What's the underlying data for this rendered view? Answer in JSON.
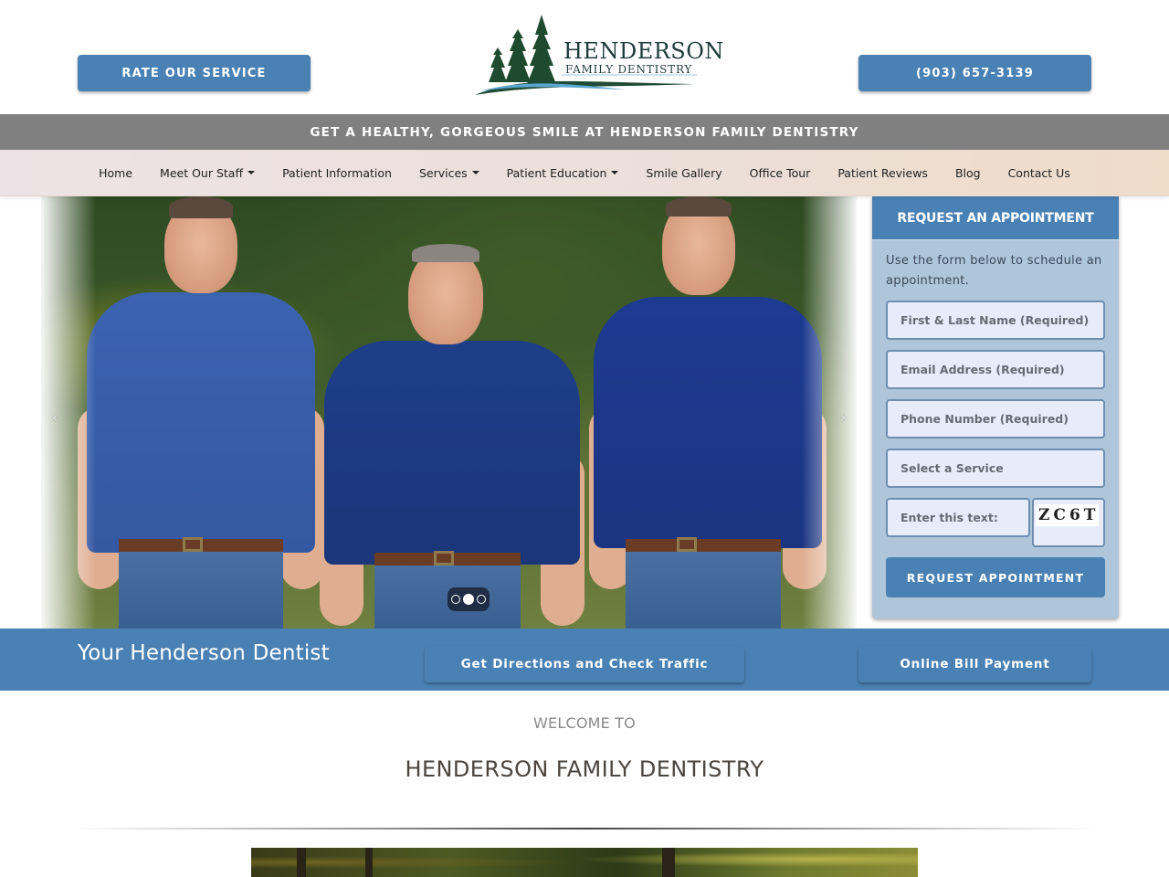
{
  "header": {
    "rate_button": "RATE OUR SERVICE",
    "phone_button": "(903) 657-3139",
    "logo": {
      "name": "HENDERSON",
      "subtitle": "FAMILY DENTISTRY",
      "icon": "pine-trees-logo-icon"
    }
  },
  "tagline": "GET A HEALTHY, GORGEOUS SMILE AT HENDERSON FAMILY DENTISTRY",
  "nav": {
    "items": [
      {
        "label": "Home",
        "dropdown": false
      },
      {
        "label": "Meet Our Staff",
        "dropdown": true
      },
      {
        "label": "Patient Information",
        "dropdown": false
      },
      {
        "label": "Services",
        "dropdown": true
      },
      {
        "label": "Patient Education",
        "dropdown": true
      },
      {
        "label": "Smile Gallery",
        "dropdown": false
      },
      {
        "label": "Office Tour",
        "dropdown": false
      },
      {
        "label": "Patient Reviews",
        "dropdown": false
      },
      {
        "label": "Blog",
        "dropdown": false
      },
      {
        "label": "Contact Us",
        "dropdown": false
      }
    ]
  },
  "hero": {
    "prev_icon": "‹",
    "next_icon": "›",
    "slides_total": 3,
    "active_slide": 2
  },
  "appointment": {
    "title": "REQUEST AN APPOINTMENT",
    "intro": "Use the form below to schedule an appointment.",
    "fields": {
      "name_placeholder": "First & Last Name (Required)",
      "email_placeholder": "Email Address (Required)",
      "phone_placeholder": "Phone Number (Required)",
      "service_selected": "Select a Service",
      "captcha_placeholder": "Enter this text:"
    },
    "captcha_text": "ZC6T",
    "submit": "REQUEST APPOINTMENT"
  },
  "band": {
    "title": "Your Henderson Dentist",
    "directions_button": "Get Directions and Check Traffic",
    "bill_button": "Online Bill Payment"
  },
  "welcome": {
    "kicker": "WELCOME TO",
    "name": "HENDERSON FAMILY DENTISTRY"
  },
  "colors": {
    "brand_blue": "#4a81b4",
    "tagline_gray": "#808080",
    "form_bg": "#afc5da",
    "logo_green": "#1f4a35"
  }
}
